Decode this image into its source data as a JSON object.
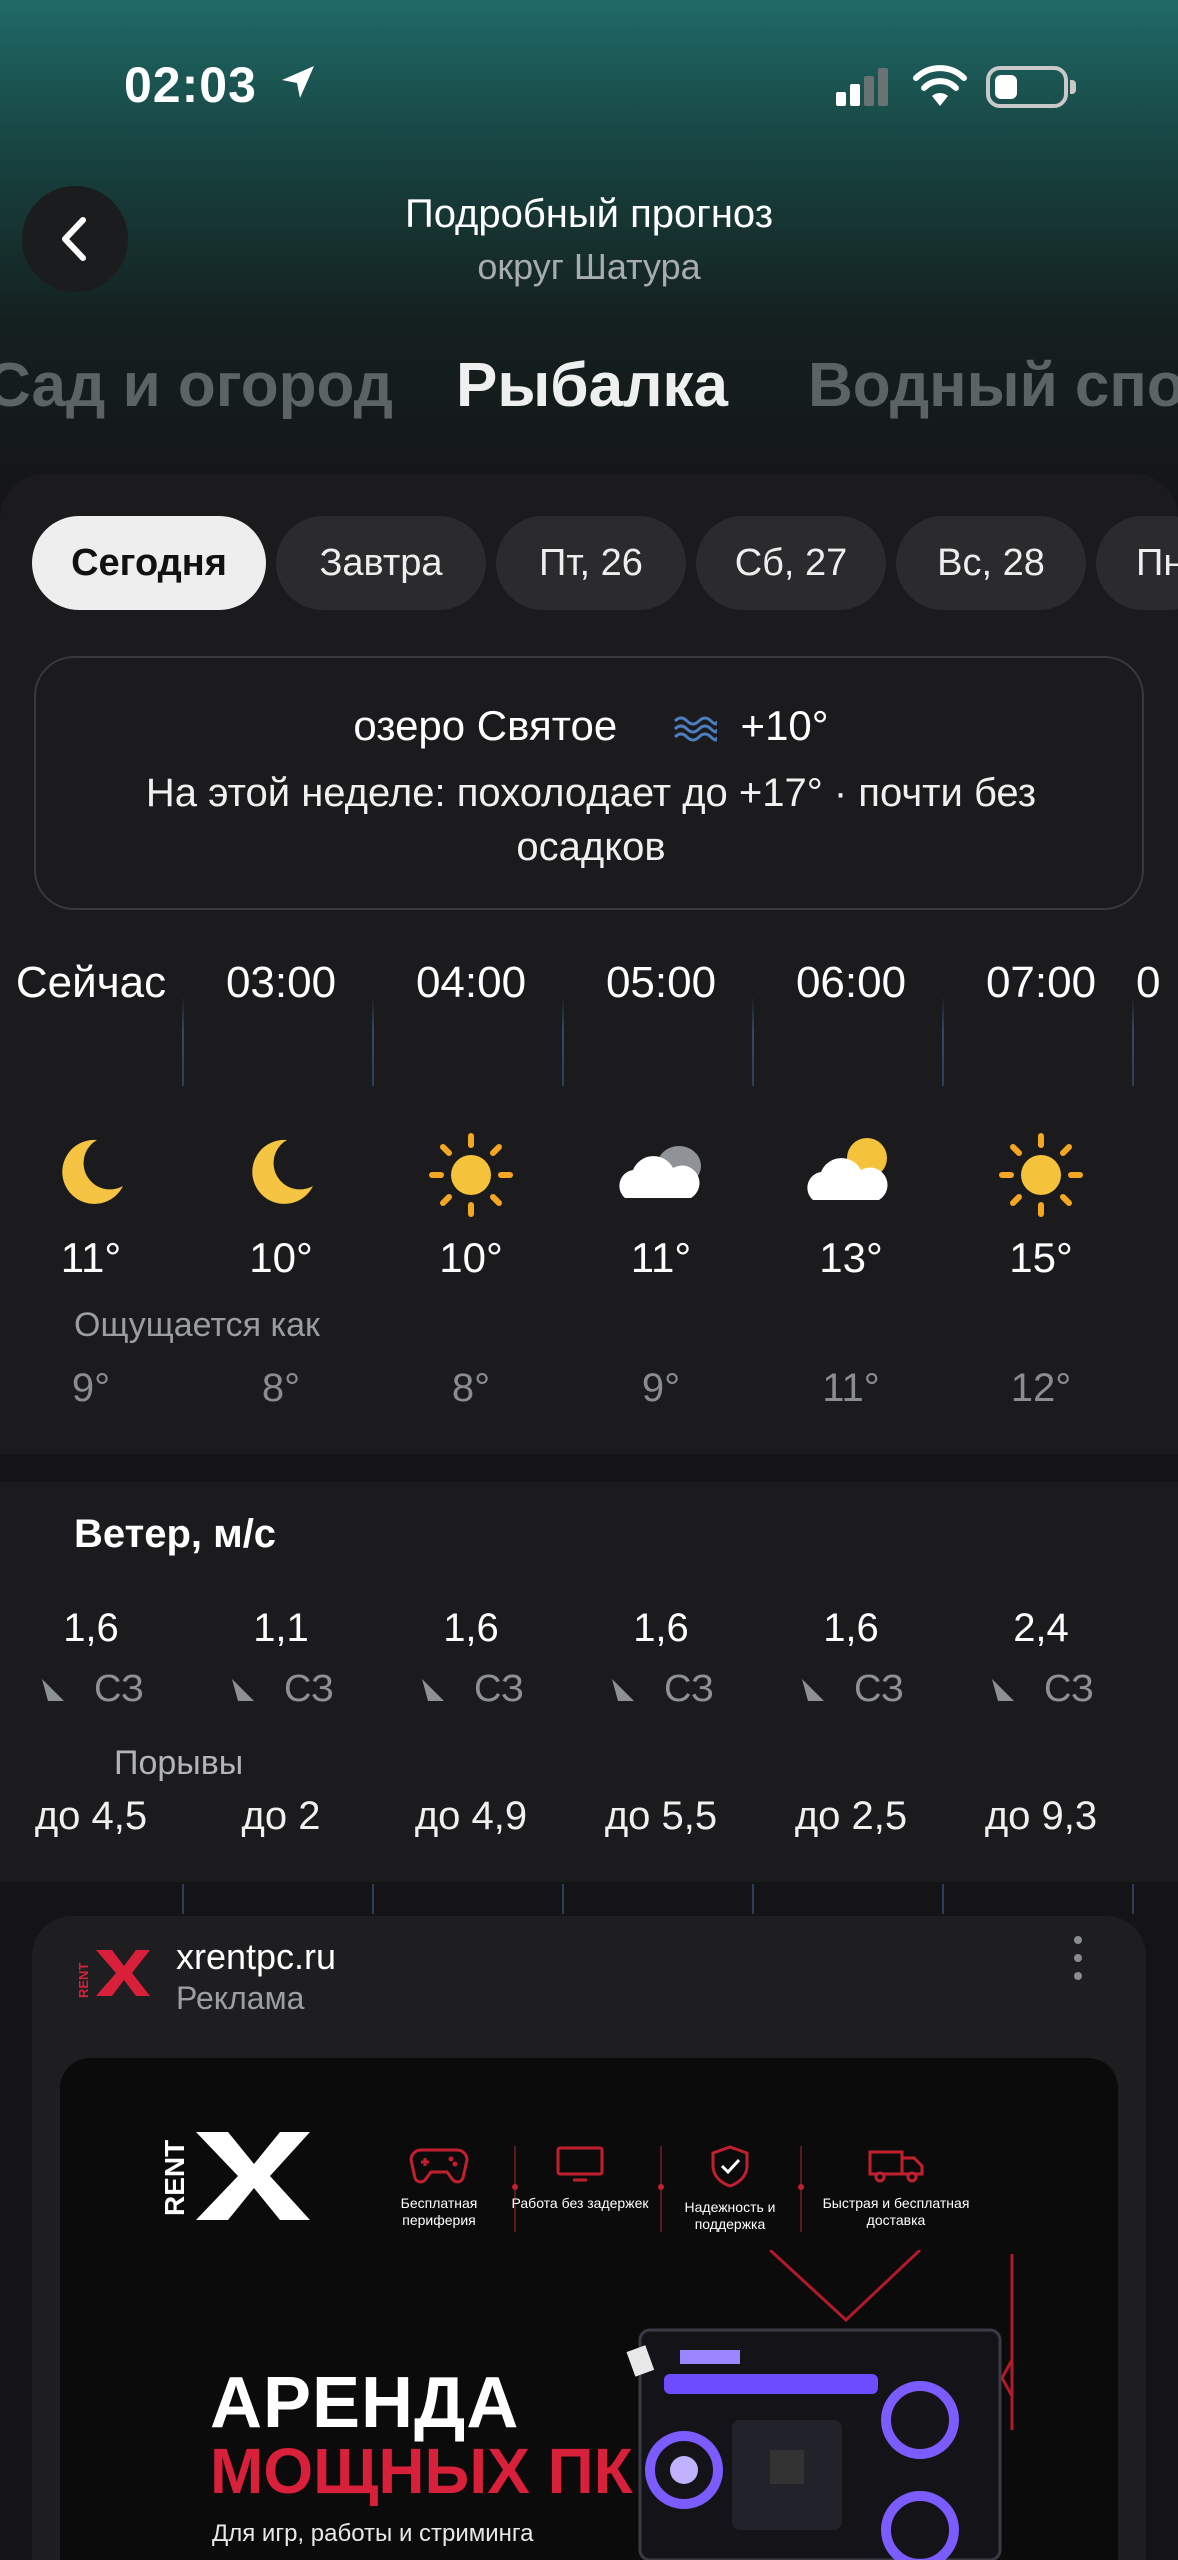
{
  "status_bar": {
    "time": "02:03"
  },
  "header": {
    "title": "Подробный прогноз",
    "subtitle": "округ Шатура"
  },
  "categories": {
    "left": "Сад и огород",
    "active": "Рыбалка",
    "right": "Водный спор"
  },
  "days": [
    "Сегодня",
    "Завтра",
    "Пт, 26",
    "Сб, 27",
    "Вс, 28",
    "Пн"
  ],
  "lake": {
    "name": "озеро Святое",
    "water_temp": "+10°",
    "summary": "На этой неделе: похолодает до +17° · почти без осадков"
  },
  "hourly": {
    "times": [
      "Сейчас",
      "03:00",
      "04:00",
      "05:00",
      "06:00",
      "07:00"
    ],
    "icons": [
      "moon-icon",
      "moon-icon",
      "sun-icon",
      "cloud-icon",
      "partly-cloudy-icon",
      "sun-icon"
    ],
    "temps": [
      "11°",
      "10°",
      "10°",
      "11°",
      "13°",
      "15°"
    ],
    "feels_label": "Ощущается как",
    "feels": [
      "9°",
      "8°",
      "8°",
      "9°",
      "11°",
      "12°"
    ]
  },
  "wind": {
    "title": "Ветер, м/с",
    "speeds": [
      "1,6",
      "1,1",
      "1,6",
      "1,6",
      "1,6",
      "2,4"
    ],
    "directions": [
      "СЗ",
      "СЗ",
      "СЗ",
      "СЗ",
      "СЗ",
      "СЗ"
    ],
    "gust_label": "Порывы",
    "gusts": [
      "до 4,5",
      "до 2",
      "до 4,9",
      "до 5,5",
      "до 2,5",
      "до 9,3"
    ]
  },
  "ad": {
    "domain": "xrentpc.ru",
    "label": "Реклама",
    "logo_text": "RENT",
    "features": [
      "Бесплатная периферия",
      "Работа без задержек",
      "Надежность и поддержка",
      "Быстрая и бесплатная доставка"
    ],
    "title1": "АРЕНДА",
    "title2": "МОЩНЫХ ПК",
    "subtitle": "Для игр, работы и стриминга"
  },
  "colors": {
    "accent_red": "#d8203a",
    "sun": "#f5c33b",
    "moon": "#f6c443",
    "panel": "#1b1b1d"
  }
}
